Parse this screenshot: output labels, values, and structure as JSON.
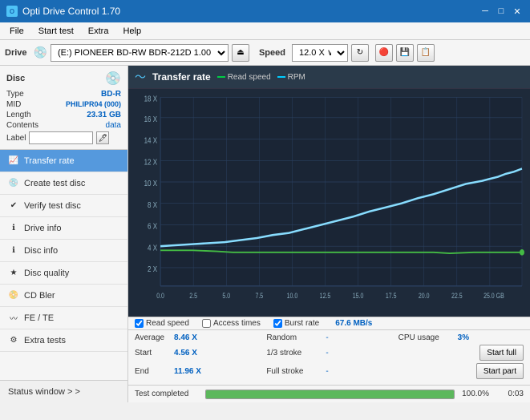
{
  "titleBar": {
    "title": "Opti Drive Control 1.70",
    "minimize": "─",
    "maximize": "□",
    "close": "✕"
  },
  "menuBar": {
    "items": [
      "File",
      "Start test",
      "Extra",
      "Help"
    ]
  },
  "toolbar": {
    "driveLabel": "Drive",
    "driveValue": "(E:)  PIONEER BD-RW   BDR-212D 1.00",
    "speedLabel": "Speed",
    "speedValue": "12.0 X ∨"
  },
  "disc": {
    "title": "Disc",
    "typeLabel": "Type",
    "typeValue": "BD-R",
    "midLabel": "MID",
    "midValue": "PHILIPR04 (000)",
    "lengthLabel": "Length",
    "lengthValue": "23.31 GB",
    "contentsLabel": "Contents",
    "contentsValue": "data",
    "labelLabel": "Label",
    "labelValue": ""
  },
  "nav": {
    "items": [
      {
        "id": "transfer-rate",
        "label": "Transfer rate",
        "active": true
      },
      {
        "id": "create-test-disc",
        "label": "Create test disc",
        "active": false
      },
      {
        "id": "verify-test-disc",
        "label": "Verify test disc",
        "active": false
      },
      {
        "id": "drive-info",
        "label": "Drive info",
        "active": false
      },
      {
        "id": "disc-info",
        "label": "Disc info",
        "active": false
      },
      {
        "id": "disc-quality",
        "label": "Disc quality",
        "active": false
      },
      {
        "id": "cd-bler",
        "label": "CD Bler",
        "active": false
      },
      {
        "id": "fe-te",
        "label": "FE / TE",
        "active": false
      },
      {
        "id": "extra-tests",
        "label": "Extra tests",
        "active": false
      }
    ],
    "statusWindow": "Status window > >"
  },
  "chart": {
    "title": "Transfer rate",
    "legendReadSpeed": "Read speed",
    "legendRPM": "RPM",
    "readSpeedColor": "#00cc44",
    "rpmColor": "#00ccff",
    "yLabels": [
      "18 X",
      "16 X",
      "14 X",
      "12 X",
      "10 X",
      "8 X",
      "6 X",
      "4 X",
      "2 X"
    ],
    "xLabels": [
      "0.0",
      "2.5",
      "5.0",
      "7.5",
      "10.0",
      "12.5",
      "15.0",
      "17.5",
      "20.0",
      "22.5",
      "25.0 GB"
    ]
  },
  "checkboxes": {
    "readSpeed": {
      "label": "Read speed",
      "checked": true
    },
    "accessTimes": {
      "label": "Access times",
      "checked": false
    },
    "burstRate": {
      "label": "Burst rate",
      "checked": true
    },
    "burstValue": "67.6 MB/s"
  },
  "stats": {
    "averageLabel": "Average",
    "averageValue": "8.46 X",
    "randomLabel": "Random",
    "randomValue": "-",
    "cpuLabel": "CPU usage",
    "cpuValue": "3%",
    "startLabel": "Start",
    "startValue": "4.56 X",
    "strokeLabel": "1/3 stroke",
    "strokeValue": "-",
    "startFullBtn": "Start full",
    "endLabel": "End",
    "endValue": "11.96 X",
    "fullStrokeLabel": "Full stroke",
    "fullStrokeValue": "-",
    "startPartBtn": "Start part"
  },
  "statusBar": {
    "statusText": "Test completed",
    "progressPercent": 100,
    "progressLabel": "100.0%",
    "timeValue": "0:03"
  }
}
